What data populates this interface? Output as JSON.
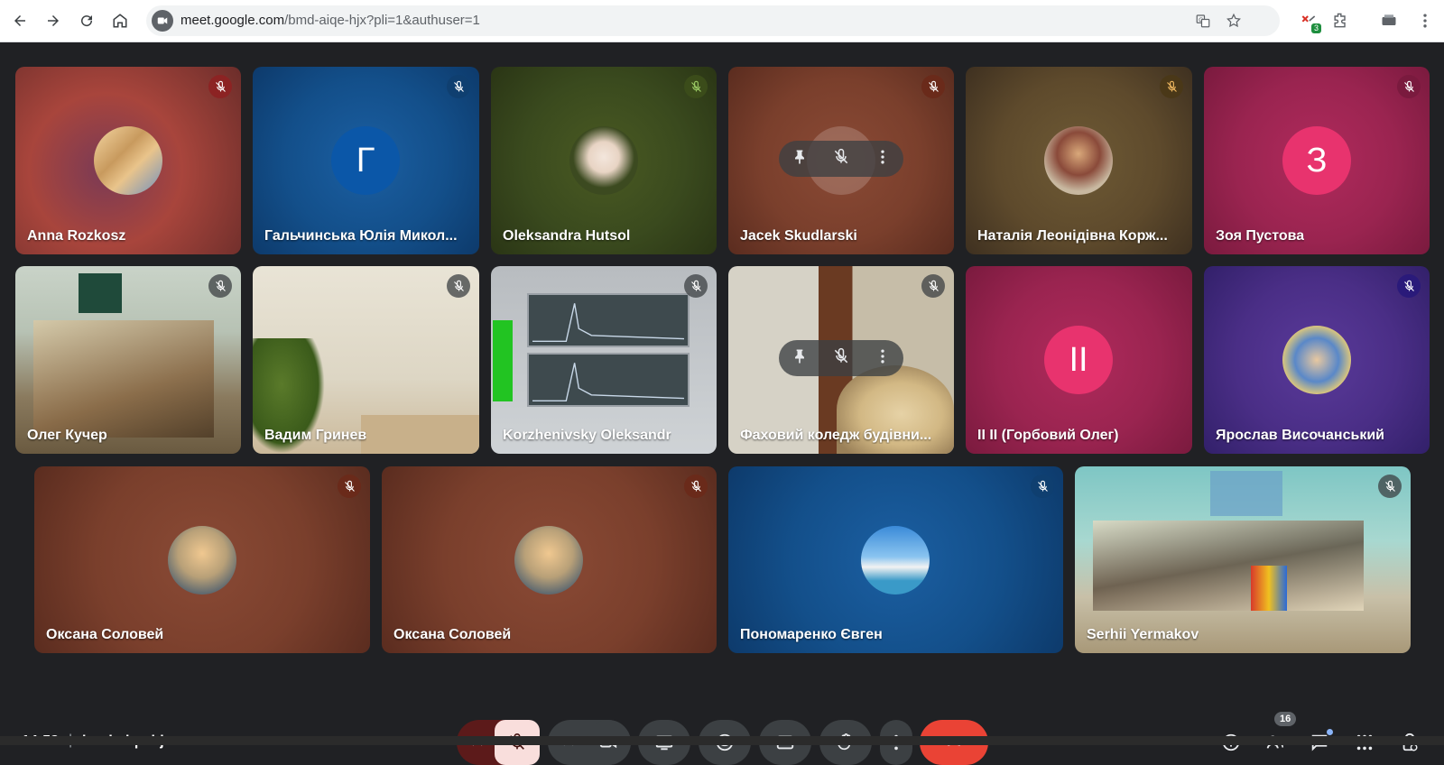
{
  "browser": {
    "url_host": "meet.google.com",
    "url_path": "/bmd-aiqe-hjx?pli=1&authuser=1",
    "extension_badge": "3"
  },
  "tiles": [
    {
      "name": "Anna Rozkosz"
    },
    {
      "name": "Гальчинська Юлія Микол...",
      "initial": "Г"
    },
    {
      "name": "Oleksandra Hutsol"
    },
    {
      "name": "Jacek Skudlarski"
    },
    {
      "name": "Наталія Леонідівна Корж..."
    },
    {
      "name": "Зоя Пустова",
      "initial": "З"
    },
    {
      "name": "Олег Кучер"
    },
    {
      "name": "Вадим Гринев"
    },
    {
      "name": "Korzhenivsky Oleksandr"
    },
    {
      "name": "Фаховий коледж будівни..."
    },
    {
      "name": "II II (Горбовий Олег)",
      "initial": "II"
    },
    {
      "name": "Ярослав Височанський"
    },
    {
      "name": "Оксана Соловей"
    },
    {
      "name": "Оксана Соловей"
    },
    {
      "name": "Пономаренко Євген"
    },
    {
      "name": "Serhii Yermakov"
    }
  ],
  "meeting": {
    "time": "14:58",
    "separator": "|",
    "code": "bmd-aiqe-hjx",
    "participants_count": "16"
  },
  "colors": {
    "end_call": "#ea4335",
    "mic_off": "#f9dedc",
    "accent": "#8ab4f8"
  }
}
